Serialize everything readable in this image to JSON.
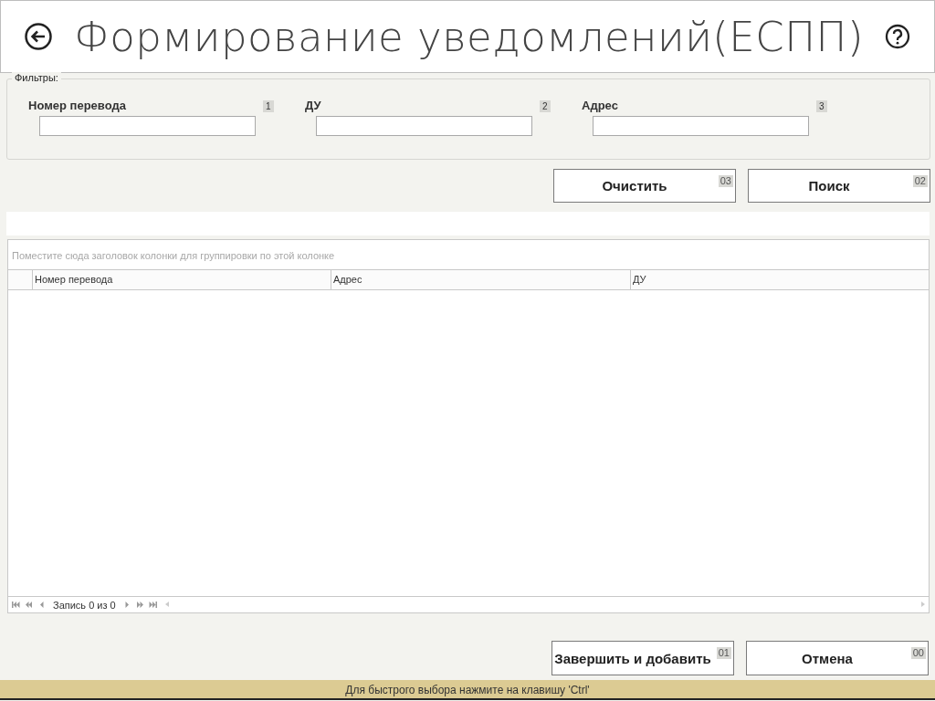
{
  "window": {
    "title": "Формирование уведомлений(ЕСПП)"
  },
  "filters": {
    "legend": "Фильтры:",
    "fields": [
      {
        "label": "Номер перевода",
        "shortcut": "1"
      },
      {
        "label": "ДУ",
        "shortcut": "2"
      },
      {
        "label": "Адрес",
        "shortcut": "3"
      }
    ]
  },
  "filter_buttons": [
    {
      "label": "Очистить",
      "shortcut": "03"
    },
    {
      "label": "Поиск",
      "shortcut": "02"
    }
  ],
  "grid": {
    "group_panel_hint": "Поместите сюда заголовок колонки для группировки по этой колонке",
    "columns": [
      "Номер перевода",
      "Адрес",
      "ДУ"
    ],
    "pager": {
      "record_text": "Запись 0 из 0"
    }
  },
  "footer_buttons": [
    {
      "label": "Завершить и добавить",
      "shortcut": "01"
    },
    {
      "label": "Отмена",
      "shortcut": "00"
    }
  ],
  "status_bar": {
    "text": "Для быстрого выбора нажмите на клавишу 'Ctrl'"
  }
}
